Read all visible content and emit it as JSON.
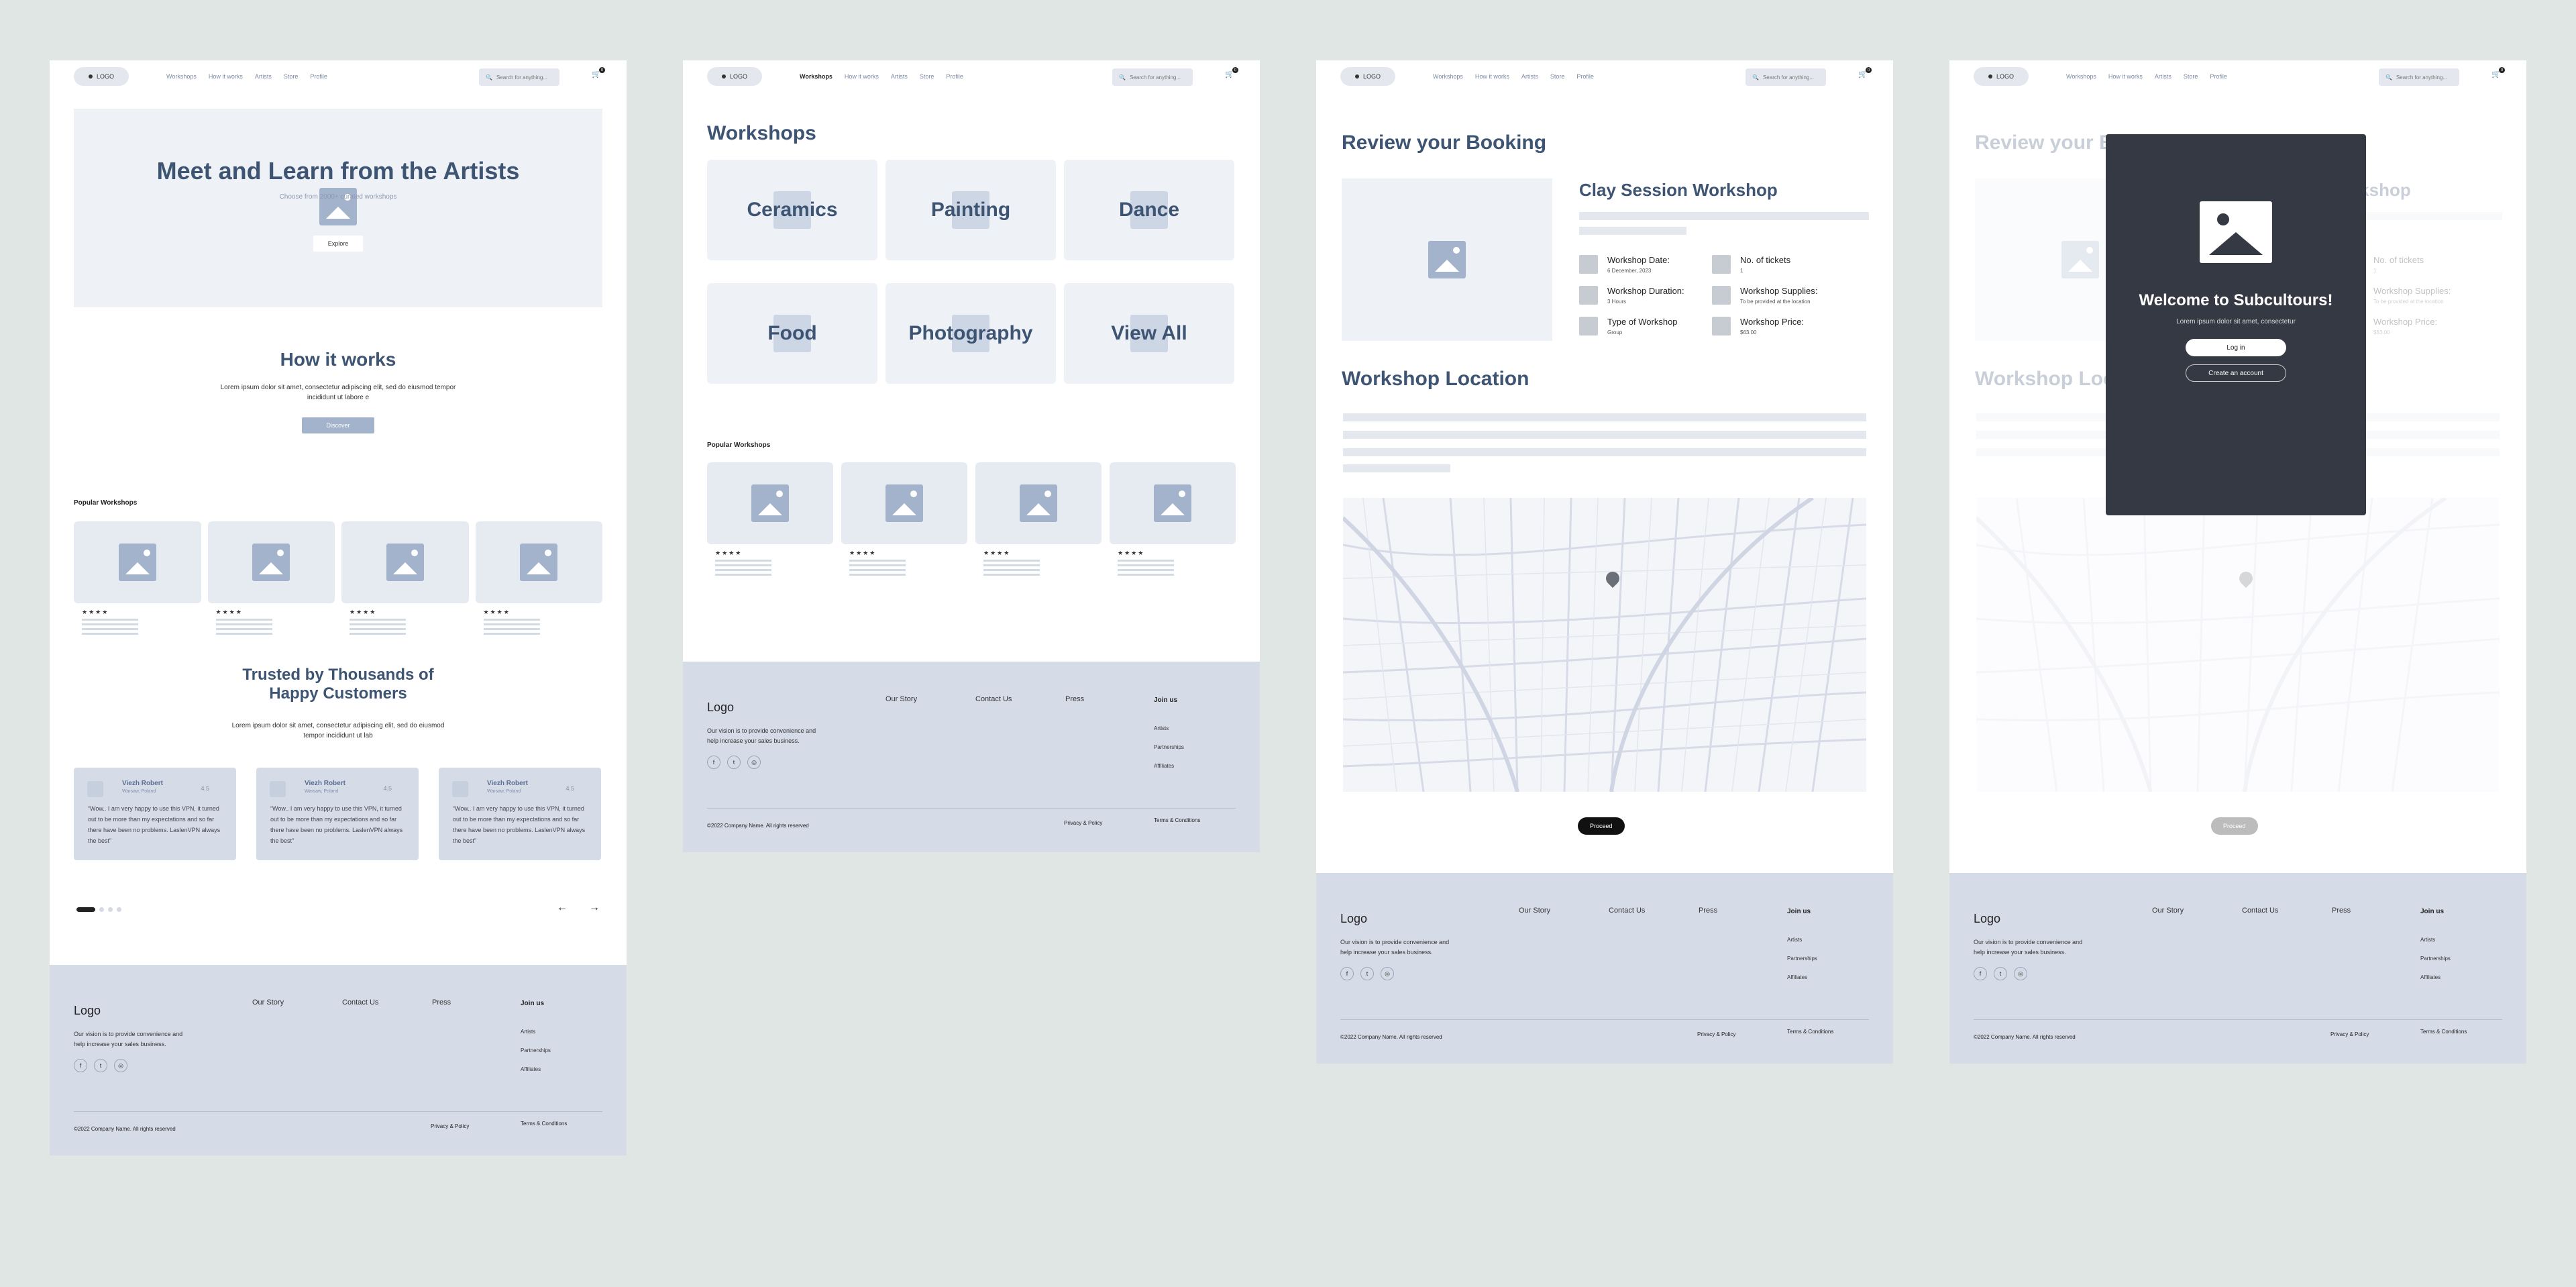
{
  "nav": {
    "logo": "LOGO",
    "links": [
      "Workshops",
      "How it works",
      "Artists",
      "Store",
      "Profile"
    ],
    "search_placeholder": "Search for anything...",
    "cart_count": "0"
  },
  "home": {
    "hero_title": "Meet and Learn from the Artists",
    "hero_sub": "Choose from 2000+ curated workshops",
    "explore": "Explore",
    "how_title": "How it works",
    "how_text": "Lorem ipsum dolor sit amet, consectetur adipiscing elit, sed do eiusmod tempor incididunt ut labore e",
    "discover": "Discover",
    "popular": "Popular Workshops",
    "stars": "★★★★",
    "trusted_title_1": "Trusted by Thousands of",
    "trusted_title_2": "Happy Customers",
    "trusted_text": "Lorem ipsum dolor sit amet, consectetur adipiscing elit, sed do eiusmod tempor incididunt ut lab",
    "testimonials": [
      {
        "name": "Viezh Robert",
        "loc": "Warsaw, Poland",
        "rate": "4.5",
        "text": "“Wow.. I am very happy to use this VPN, it turned out to be more than my expectations and so far there have been no problems. LaslenVPN always the best”"
      },
      {
        "name": "Viezh Robert",
        "loc": "Warsaw, Poland",
        "rate": "4.5",
        "text": "“Wow.. I am very happy to use this VPN, it turned out to be more than my expectations and so far there have been no problems. LaslenVPN always the best”"
      },
      {
        "name": "Viezh Robert",
        "loc": "Warsaw, Poland",
        "rate": "4.5",
        "text": "“Wow.. I am very happy to use this VPN, it turned out to be more than my expectations and so far there have been no problems. LaslenVPN always the best”"
      }
    ],
    "prev_arrow": "←",
    "next_arrow": "→"
  },
  "workshops": {
    "title": "Workshops",
    "categories": [
      "Ceramics",
      "Painting",
      "Dance",
      "Food",
      "Photography",
      "View All"
    ],
    "popular": "Popular Workshops",
    "stars": "★★★★"
  },
  "booking": {
    "title": "Review your Booking",
    "workshop_name": "Clay Session Workshop",
    "specs": [
      {
        "k": "Workshop Date:",
        "v": "6 December, 2023"
      },
      {
        "k": "No. of tickets",
        "v": "1"
      },
      {
        "k": "Workshop Duration:",
        "v": "3 Hours"
      },
      {
        "k": "Workshop Supplies:",
        "v": "To be provided at the location"
      },
      {
        "k": "Type of Workshop",
        "v": "Group"
      },
      {
        "k": "Workshop Price:",
        "v": "$63.00"
      }
    ],
    "location_title": "Workshop Location",
    "proceed": "Proceed"
  },
  "modal": {
    "title": "Welcome to Subcultours!",
    "sub": "Lorem ipsum dolor sit amet, consectetur",
    "login": "Log in",
    "create": "Create an account"
  },
  "footer": {
    "logo": "Logo",
    "vision": "Our vision is to provide convenience and help increase your sales business.",
    "cols": [
      "Our Story",
      "Contact Us",
      "Press"
    ],
    "join": "Join us",
    "join_links": [
      "Artists",
      "Partnerships",
      "Affiliates"
    ],
    "social": [
      "f",
      "t",
      "◎"
    ],
    "copyright": "©2022 Company Name. All rights reserved",
    "privacy": "Privacy & Policy",
    "terms": "Terms & Conditions"
  },
  "colors": {
    "background": "#dfe6e4",
    "accent": "#3e5473",
    "placeholder": "#a3b3cc",
    "footer": "#d6dce7",
    "modal": "#353943"
  }
}
